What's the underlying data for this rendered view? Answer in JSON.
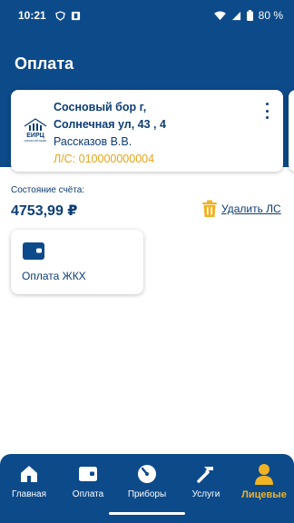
{
  "status_bar": {
    "time": "10:21",
    "battery": "80 %"
  },
  "header": {
    "title": "Оплата"
  },
  "account": {
    "logo_text": "ЕИРЦ",
    "logo_subtext": "СИБИРСКИЙ БЕРЕГ",
    "address_line1": "Сосновый бор г,",
    "address_line2": "Солнечная ул, 43 , 4",
    "owner": "Рассказов  В.В.",
    "account_number": "Л/С: 010000000004"
  },
  "balance": {
    "label": "Состояние счёта:",
    "value": "4753,99 ₽"
  },
  "delete_account": {
    "label": "Удалить ЛС"
  },
  "tiles": [
    {
      "label": "Оплата ЖКХ",
      "icon": "wallet-icon"
    }
  ],
  "bottom_nav": {
    "items": [
      {
        "label": "Главная",
        "icon": "home-icon",
        "active": false
      },
      {
        "label": "Оплата",
        "icon": "wallet-icon",
        "active": false
      },
      {
        "label": "Приборы",
        "icon": "gauge-icon",
        "active": false
      },
      {
        "label": "Услуги",
        "icon": "tools-icon",
        "active": false
      },
      {
        "label": "Лицевые",
        "icon": "person-icon",
        "active": true
      }
    ]
  },
  "colors": {
    "primary": "#0c4a8a",
    "accent": "#f0b323",
    "text": "#0c3d75"
  }
}
